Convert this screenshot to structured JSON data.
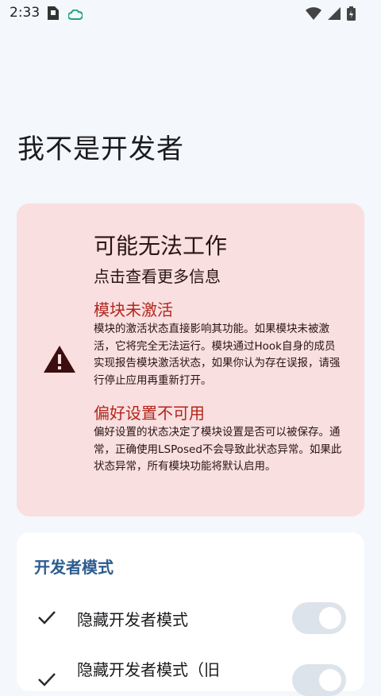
{
  "status_bar": {
    "time": "2:33",
    "left_icons": [
      "sim-card-icon",
      "cloud-icon"
    ],
    "right_icons": [
      "wifi-icon",
      "signal-icon",
      "battery-icon"
    ]
  },
  "page_title": "我不是开发者",
  "warning_card": {
    "icon": "warning-icon",
    "title": "可能无法工作",
    "subtitle": "点击查看更多信息",
    "sections": [
      {
        "title": "模块未激活",
        "body": "模块的激活状态直接影响其功能。如果模块未被激活，它将完全无法运行。模块通过Hook自身的成员实现报告模块激活状态，如果你认为存在误报，请强行停止应用再重新打开。"
      },
      {
        "title": "偏好设置不可用",
        "body": "偏好设置的状态决定了模块设置是否可以被保存。通常，正确使用LSPosed不会导致此状态异常。如果此状态异常，所有模块功能将默认启用。"
      }
    ]
  },
  "developer_card": {
    "title": "开发者模式",
    "items": [
      {
        "label": "隐藏开发者模式",
        "checked": true,
        "switch_on": false
      },
      {
        "label": "隐藏开发者模式（旧",
        "checked": true,
        "switch_on": false
      }
    ]
  },
  "colors": {
    "background": "#f4f7fb",
    "warning_card": "#f9dfdf",
    "warning_accent": "#b3261e",
    "section_accent": "#2c5c8f",
    "switch_track": "#dde3ea"
  }
}
